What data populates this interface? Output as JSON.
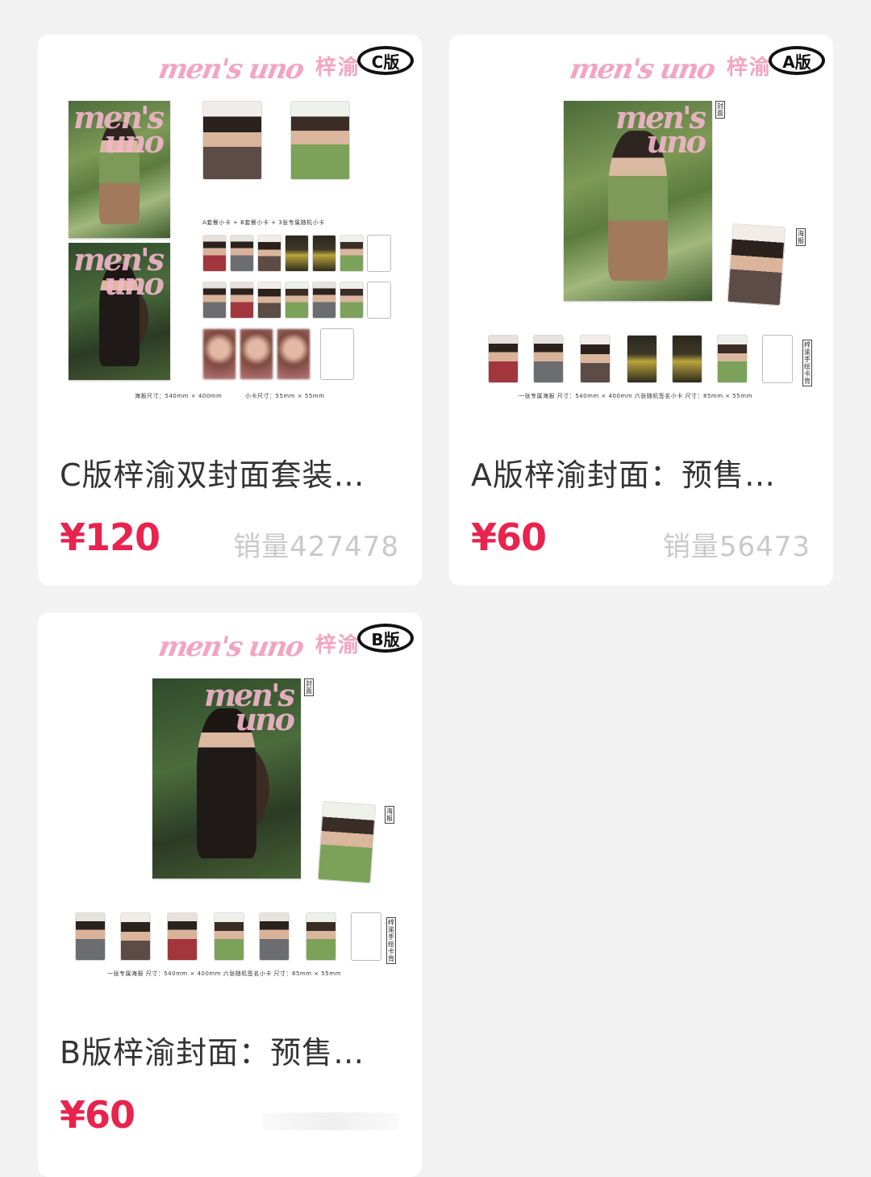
{
  "products": [
    {
      "id": "C",
      "badge": "C版",
      "brand_logo": "men's uno",
      "brand_name": "梓渝",
      "title": "C版梓渝双封面套装…",
      "price": "¥120",
      "sales": "销量427478",
      "cards_caption": "A套餐小卡 + B套餐小卡 + 3张专属随机小卡",
      "size_poster": "海报尺寸：540mm × 400mm",
      "size_card": "小卡尺寸：55mm × 55mm"
    },
    {
      "id": "A",
      "badge": "A版",
      "brand_logo": "men's uno",
      "brand_name": "梓渝",
      "title": "A版梓渝封面：预售…",
      "price": "¥60",
      "sales": "销量56473",
      "tag_cover": "封面",
      "tag_poster": "海报",
      "tag_back": "梓渝手绘卡背",
      "size_line": "一张专属海报  尺寸：540mm × 400mm      六张随机签名小卡  尺寸：85mm × 55mm"
    },
    {
      "id": "B",
      "badge": "B版",
      "brand_logo": "men's uno",
      "brand_name": "梓渝",
      "title": "B版梓渝封面：预售…",
      "price": "¥60",
      "sales": "",
      "tag_cover": "封面",
      "tag_poster": "海报",
      "tag_back": "梓渝手绘卡背",
      "size_line": "一张专属海报  尺寸：540mm × 400mm      六张随机签名小卡  尺寸：85mm × 55mm"
    }
  ]
}
